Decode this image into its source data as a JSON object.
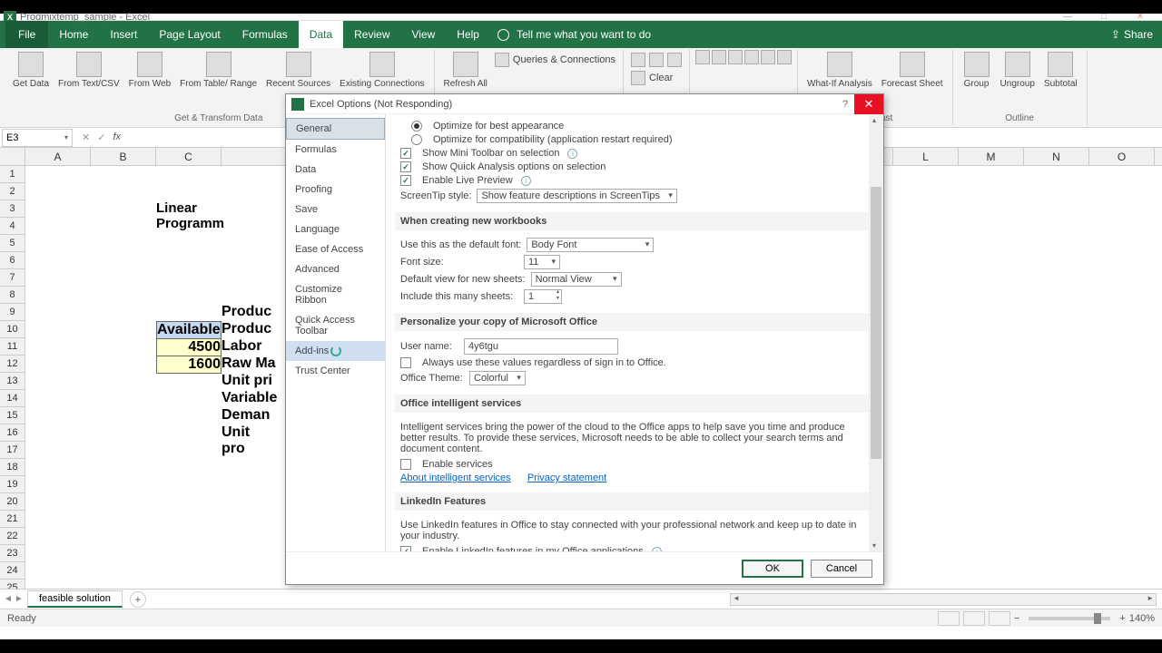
{
  "titlebar": {
    "text": "Prodmixtemp_sample - Excel"
  },
  "ribbon": {
    "file": "File",
    "tabs": [
      "Home",
      "Insert",
      "Page Layout",
      "Formulas",
      "Data",
      "Review",
      "View",
      "Help"
    ],
    "active_tab": "Data",
    "tell_me": "Tell me what you want to do",
    "share": "Share",
    "groups": {
      "get_transform": {
        "label": "Get & Transform Data",
        "items": [
          "Get Data",
          "From Text/CSV",
          "From Web",
          "From Table/ Range",
          "Recent Sources",
          "Existing Connections"
        ]
      },
      "queries": {
        "refresh": "Refresh All",
        "qc": "Queries & Connections",
        "clear": "Clear"
      },
      "analysis": {
        "whatif": "What-If Analysis",
        "forecast_sheet": "Forecast Sheet",
        "label": "Forecast"
      },
      "outline": {
        "group": "Group",
        "ungroup": "Ungroup",
        "subtotal": "Subtotal",
        "label": "Outline"
      }
    }
  },
  "name_box": "E3",
  "columns": [
    "A",
    "B",
    "C",
    "L",
    "M",
    "N",
    "O"
  ],
  "rows": 25,
  "sheet": {
    "title_text": "Linear Programm",
    "a10": "Available",
    "a11": "4500",
    "a12": "1600",
    "b9": "Produc",
    "b10": "Produc",
    "b11": "Labor",
    "b12": "Raw Ma",
    "b13": "Unit pri",
    "b14": "Variable",
    "b15": "Deman",
    "b16": "Unit pro"
  },
  "sheet_tabs": {
    "active": "feasible solution"
  },
  "status": {
    "ready": "Ready",
    "zoom": "140%"
  },
  "dialog": {
    "title": "Excel Options (Not Responding)",
    "nav": [
      "General",
      "Formulas",
      "Data",
      "Proofing",
      "Save",
      "Language",
      "Ease of Access",
      "Advanced",
      "Customize Ribbon",
      "Quick Access Toolbar",
      "Add-ins",
      "Trust Center"
    ],
    "selected_nav": "General",
    "highlight_nav": "Add-ins",
    "opt": {
      "opt_best": "Optimize for best appearance",
      "opt_compat": "Optimize for compatibility (application restart required)",
      "mini_toolbar": "Show Mini Toolbar on selection",
      "quick_analysis": "Show Quick Analysis options on selection",
      "live_preview": "Enable Live Preview",
      "screentip_label": "ScreenTip style:",
      "screentip_value": "Show feature descriptions in ScreenTips"
    },
    "sections": {
      "new_wb": "When creating new workbooks",
      "personalize": "Personalize your copy of Microsoft Office",
      "intelligent": "Office intelligent services",
      "linkedin": "LinkedIn Features"
    },
    "new_wb": {
      "font_label": "Use this as the default font:",
      "font_value": "Body Font",
      "size_label": "Font size:",
      "size_value": "11",
      "view_label": "Default view for new sheets:",
      "view_value": "Normal View",
      "sheets_label": "Include this many sheets:",
      "sheets_value": "1"
    },
    "personalize": {
      "username_label": "User name:",
      "username_value": "4y6tgu",
      "always": "Always use these values regardless of sign in to Office.",
      "theme_label": "Office Theme:",
      "theme_value": "Colorful"
    },
    "intelligent": {
      "desc": "Intelligent services bring the power of the cloud to the Office apps to help save you time and produce better results. To provide these services, Microsoft needs to be able to collect your search terms and document content.",
      "enable": "Enable services",
      "about": "About intelligent services",
      "privacy": "Privacy statement"
    },
    "linkedin": {
      "desc": "Use LinkedIn features in Office to stay connected with your professional network and keep up to date in your industry.",
      "enable": "Enable LinkedIn features in my Office applications"
    },
    "buttons": {
      "ok": "OK",
      "cancel": "Cancel"
    }
  }
}
